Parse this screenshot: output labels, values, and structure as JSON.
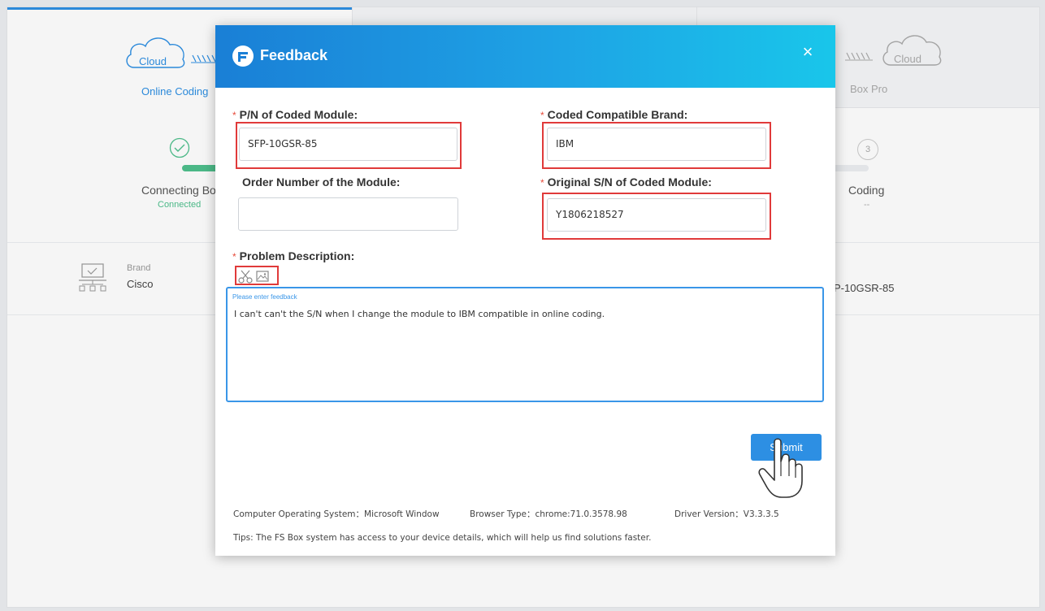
{
  "background": {
    "tabs": {
      "online": {
        "cloud_label": "Cloud",
        "label": "Online Coding"
      },
      "box": {
        "cloud_label": "Cloud",
        "label": "Box Pro"
      }
    },
    "steps": {
      "step1": {
        "title": "Connecting Box",
        "status": "Connected"
      },
      "step3": {
        "number": "3",
        "title": "Coding",
        "status": "--"
      }
    },
    "device": {
      "brand_label": "Brand",
      "brand_value": "Cisco",
      "module_value": "P-10GSR-85"
    }
  },
  "modal": {
    "title": "Feedback",
    "close_symbol": "×",
    "fields": {
      "pn": {
        "label": "P/N of Coded Module:",
        "value": "SFP-10GSR-85",
        "required": "*"
      },
      "brand": {
        "label": "Coded Compatible Brand:",
        "value": "IBM",
        "required": "*"
      },
      "order": {
        "label": "Order Number of the Module:",
        "value": ""
      },
      "sn": {
        "label": "Original S/N of Coded Module:",
        "value": "Y1806218527",
        "required": "*"
      }
    },
    "problem": {
      "label": "Problem Description:",
      "required": "*",
      "placeholder": "Please enter feedback",
      "text": "I can't can't the S/N when I change the module to IBM compatible in online coding."
    },
    "submit_label": "Submit",
    "system_info": {
      "os": "Computer Operating System：Microsoft Window",
      "browser": "Browser Type：chrome:71.0.3578.98",
      "driver": "Driver Version：V3.3.3.5"
    },
    "tips": "Tips: The FS Box system has access to your device details, which will help us find solutions faster."
  },
  "colors": {
    "accent": "#2d8fe3",
    "highlight": "#e03a3a",
    "success": "#4fc08d"
  }
}
